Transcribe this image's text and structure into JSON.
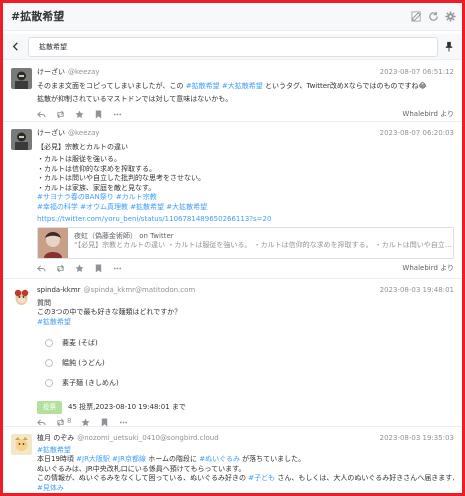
{
  "window": {
    "title": "#拡散希望"
  },
  "search": {
    "value": "拡散希望"
  },
  "statuses": [
    {
      "display_name": "けーざい",
      "acct": "@keezay",
      "time": "2023-08-07 06:51:12",
      "lines": [
        "そのまま文面をコピってしまいましたが、この ",
        "#拡散希望",
        " ",
        "#大拡散希望",
        " というタグ、Twitter改めXならではのものですね😂"
      ],
      "line2": "拡散が抑制されているマストドンでは対して意味はないかも。",
      "via": "Whalebird より"
    },
    {
      "display_name": "けーざい",
      "acct": "@keezay",
      "time": "2023-08-07 06:20:03",
      "title": "【必見】宗教とカルトの違い",
      "bullets": [
        "・カルトは服従を強いる。",
        "・カルトは信仰的な求めを搾取する。",
        "・カルトは問いや自立した批判的な思考をさせない。",
        "・カルトは家族、家庭を敵と見なす。"
      ],
      "tags1": "#サヨナラ春のBAN祭り #カルト宗教",
      "tags2": "#幸福の科学 #オウム真理教 #拡散希望 #大拡散希望",
      "link": "https://twitter.com/yoru_beni/status/1106781489650266113?s=20",
      "card_title": "夜虹（偽藤金術師） on Twitter",
      "card_desc": "“【必見】宗教とカルトの違い ・カルトは服従を強いる。 ・カルトは信仰的な求めを搾取する。 ・カルトは問いや自立した批…",
      "via": "Whalebird より"
    },
    {
      "display_name": "spinda-kkmr",
      "acct": "@spinda_kkmr@matitodon.com",
      "time": "2023-08-03 19:48:01",
      "l1": "質問",
      "l2": "この3つの中で最も好きな麺類はどれですか？",
      "tag": "#拡散希望",
      "options": [
        "蕎麦 (そば)",
        "饂飩 (うどん)",
        "素子麺 (きしめん)"
      ],
      "vote": "投票",
      "poll_info": "45 投票,2023-08-10 19:48:01 まで",
      "reblogs": "8"
    },
    {
      "display_name": "植月 のぞみ",
      "acct": "@nozomi_uetsuki_0410@songbird.cloud",
      "time": "2023-08-03 19:35:03",
      "tag": "#拡散希望",
      "l1": [
        "本日19時頃 ",
        "#JR大阪駅",
        " ",
        "#JR京都線",
        " ホームの階段に ",
        "#ぬいぐるみ",
        " が落ちていました。"
      ],
      "l2": "ぬいぐるみは、JR中央改札口にいる係員へ預けてもらっています。",
      "l3": [
        "この情報が、ぬいぐるみをなくして困っている、ぬいぐるみ好きの ",
        "#子ども",
        " さん、もしくは、大人のぬいぐるみ好きさんへ届きますように。"
      ],
      "l4": "#見体み"
    }
  ],
  "colors": {
    "accent": "#409eff",
    "frame": "#ee1c24"
  }
}
